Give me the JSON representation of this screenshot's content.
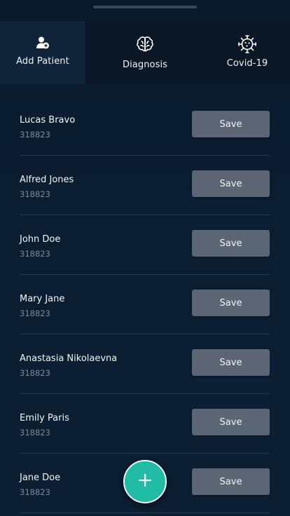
{
  "tabs": [
    {
      "label": "Add Patient",
      "icon": "add-user-icon",
      "active": true
    },
    {
      "label": "Diagnosis",
      "icon": "brain-icon",
      "active": false
    },
    {
      "label": "Covid-19",
      "icon": "virus-icon",
      "active": false
    }
  ],
  "patients": [
    {
      "name": "Lucas Bravo",
      "id": "318823",
      "action": "Save"
    },
    {
      "name": "Alfred Jones",
      "id": "318823",
      "action": "Save"
    },
    {
      "name": "John Doe",
      "id": "318823",
      "action": "Save"
    },
    {
      "name": "Mary Jane",
      "id": "318823",
      "action": "Save"
    },
    {
      "name": "Anastasia Nikolaevna",
      "id": "318823",
      "action": "Save"
    },
    {
      "name": "Emily Paris",
      "id": "318823",
      "action": "Save"
    },
    {
      "name": "Jane Doe",
      "id": "318823",
      "action": "Save"
    }
  ],
  "fab": {
    "icon": "plus-icon"
  },
  "colors": {
    "background": "#0b1d31",
    "accent": "#22bba6",
    "button": "#5b6573",
    "divider": "#253a4f"
  }
}
